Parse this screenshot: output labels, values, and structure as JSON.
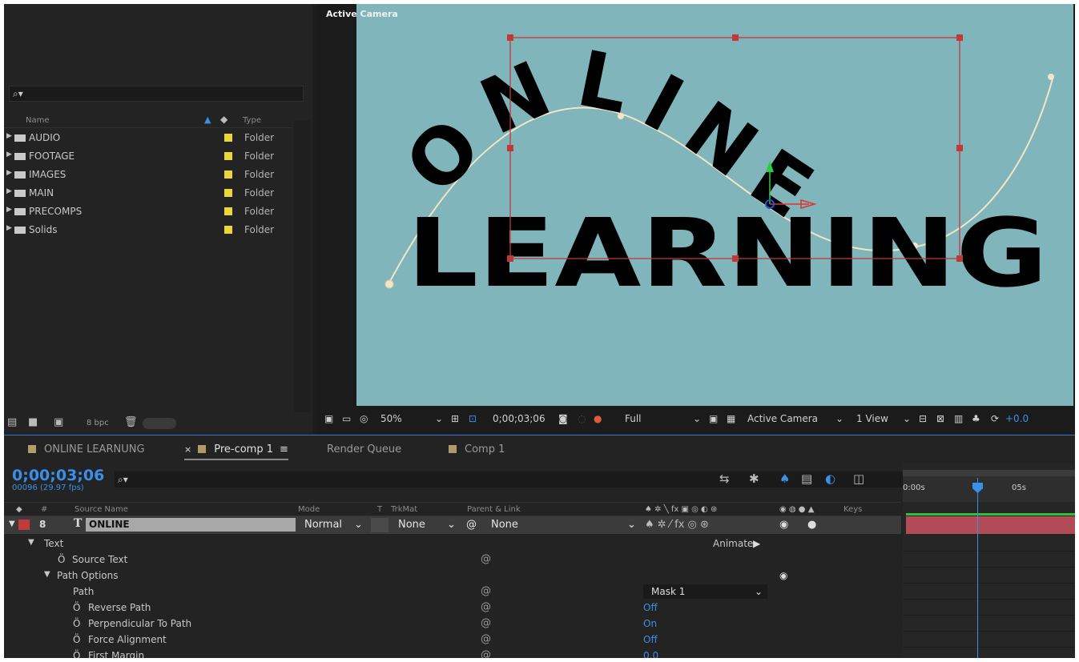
{
  "project": {
    "search_placeholder": "⌕▾",
    "columns": {
      "name": "Name",
      "type": "Type"
    },
    "items": [
      {
        "name": "AUDIO",
        "type": "Folder"
      },
      {
        "name": "FOOTAGE",
        "type": "Folder"
      },
      {
        "name": "IMAGES",
        "type": "Folder"
      },
      {
        "name": "MAIN",
        "type": "Folder"
      },
      {
        "name": "PRECOMPS",
        "type": "Folder"
      },
      {
        "name": "Solids",
        "type": "Folder"
      }
    ],
    "bpc": "8 bpc"
  },
  "viewer": {
    "camera_label": "Active Camera",
    "text_line1": "ONLINE",
    "text_line2": "LEARNING",
    "zoom": "50%",
    "timecode": "0;00;03;06",
    "resolution": "Full",
    "camera": "Active Camera",
    "views": "1 View",
    "exposure": "+0.0",
    "bg_color": "#80b5bb"
  },
  "tabs": [
    {
      "label": "ONLINE LEARNUNG"
    },
    {
      "label": "Pre-comp 1"
    },
    {
      "label": "Render Queue"
    },
    {
      "label": "Comp 1"
    }
  ],
  "timeline": {
    "timecode": "0;00;03;06",
    "fps": "00096 (29.97 fps)",
    "columns": {
      "num": "#",
      "source": "Source Name",
      "mode": "Mode",
      "t": "T",
      "trkmat": "TrkMat",
      "parent": "Parent & Link",
      "keys": "Keys"
    },
    "layer": {
      "number": "8",
      "name": "ONLINE",
      "mode": "Normal",
      "trkmat": "None",
      "parent": "None"
    },
    "animate": "Animate:",
    "props": {
      "text": "Text",
      "source_text": "Source Text",
      "path_options": "Path Options",
      "path": "Path",
      "path_value": "Mask 1",
      "reverse_path": "Reverse Path",
      "reverse_path_value": "Off",
      "perpendicular": "Perpendicular To Path",
      "perpendicular_value": "On",
      "force_alignment": "Force Alignment",
      "force_alignment_value": "Off",
      "first_margin": "First Margin",
      "first_margin_value": "0.0"
    },
    "ruler": {
      "start": "0:00s",
      "mark": "05s"
    }
  }
}
